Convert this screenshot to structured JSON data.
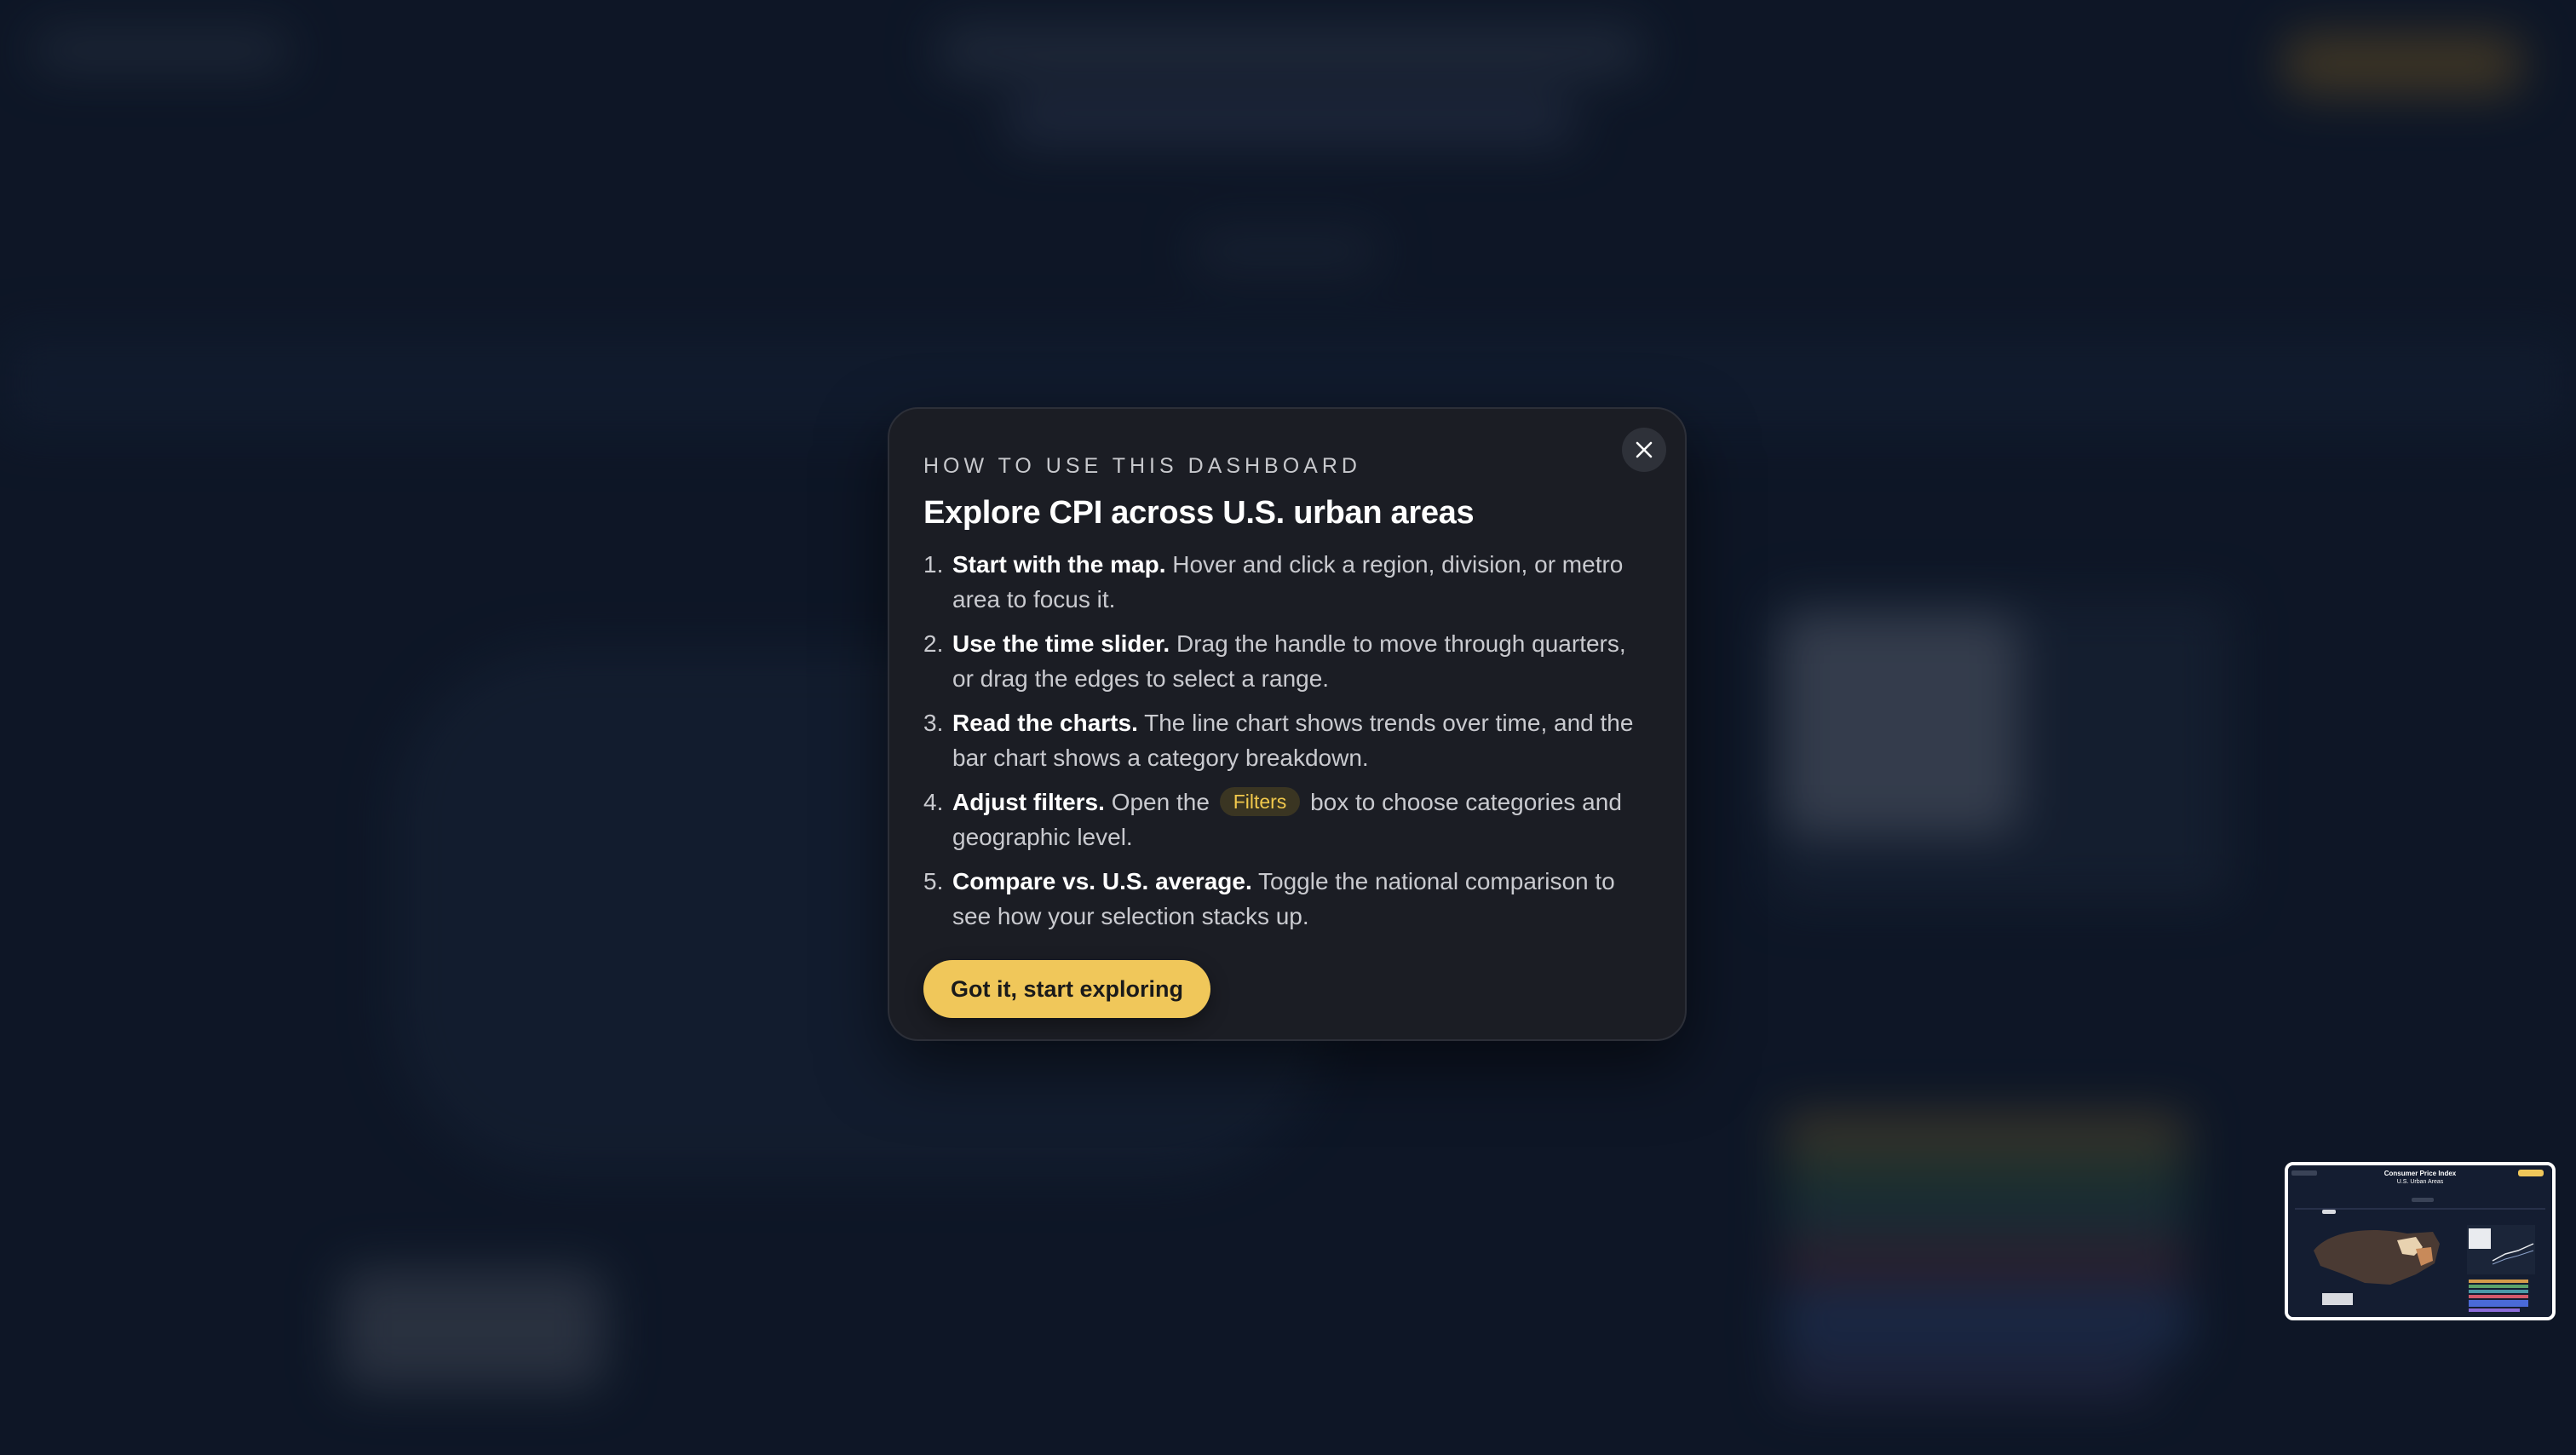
{
  "modal": {
    "eyebrow": "HOW TO USE THIS DASHBOARD",
    "title": "Explore CPI across U.S. urban areas",
    "steps": [
      {
        "num": "1.",
        "strong": "Start with the map.",
        "text": " Hover and click a region, division, or metro area to focus it."
      },
      {
        "num": "2.",
        "strong": "Use the time slider.",
        "text": " Drag the handle to move through quarters, or drag the edges to select a range."
      },
      {
        "num": "3.",
        "strong": "Read the charts.",
        "text": " The line chart shows trends over time, and the bar chart shows a category breakdown."
      },
      {
        "num": "4.",
        "strong": "Adjust filters.",
        "text_before": " Open the ",
        "chip": "Filters",
        "text_after": " box to choose categories and geographic level."
      },
      {
        "num": "5.",
        "strong": "Compare vs. U.S. average.",
        "text": " Toggle the national comparison to see how your selection stacks up."
      }
    ],
    "cta_label": "Got it, start exploring",
    "close_icon": "close-icon"
  },
  "minimap": {
    "title_line1": "Consumer Price Index",
    "title_line2": "U.S. Urban Areas"
  },
  "colors": {
    "accent": "#f0c75a",
    "modal_bg": "#1b1d24",
    "page_bg": "#111a2c"
  }
}
